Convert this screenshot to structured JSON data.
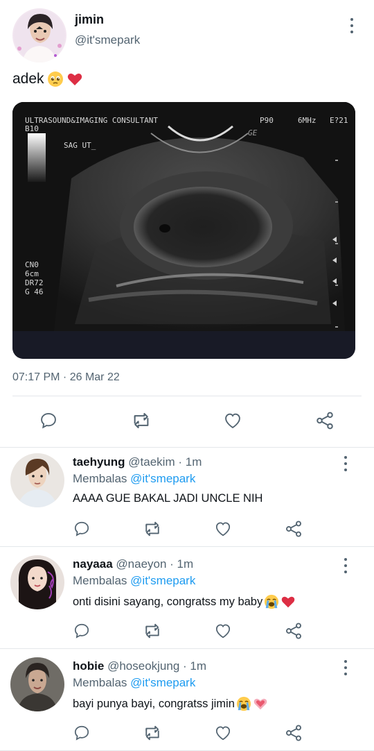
{
  "tweet": {
    "author_name": "jimin",
    "author_handle": "@it'smepark",
    "text": "adek",
    "emojis": [
      "pleading-face-emoji",
      "red-heart-emoji"
    ],
    "timestamp": "07:17 PM · 26 Mar 22",
    "media": {
      "header_left": "ULTRASOUND&IMAGING CONSULTANT",
      "header_p": "P90",
      "header_mhz": "6MHz",
      "header_e": "E?21",
      "b_value": "B10",
      "ge": "GE",
      "sag": "SAG UT_",
      "params": [
        "CN0",
        "6cm",
        "DR72",
        "G 46"
      ]
    }
  },
  "actions": [
    "reply-icon",
    "retweet-icon",
    "like-icon",
    "share-icon"
  ],
  "replies": [
    {
      "name": "taehyung",
      "handle": "@taekim",
      "time": "· 1m",
      "replying_prefix": "Membalas",
      "replying_to": "@it'smepark",
      "text": "AAAA GUE BAKAL JADI UNCLE NIH",
      "emojis": []
    },
    {
      "name": "nayaaa",
      "handle": "@naeyon",
      "time": "· 1m",
      "replying_prefix": "Membalas",
      "replying_to": "@it'smepark",
      "text": "onti disini sayang, congratss my baby",
      "emojis": [
        "loudly-crying-face-emoji",
        "red-heart-emoji"
      ]
    },
    {
      "name": "hobie",
      "handle": "@hoseokjung",
      "time": "· 1m",
      "replying_prefix": "Membalas",
      "replying_to": "@it'smepark",
      "text": "bayi punya bayi, congratss jimin",
      "emojis": [
        "loudly-crying-face-emoji",
        "growing-heart-emoji"
      ]
    }
  ],
  "colors": {
    "link": "#1d9bf0",
    "secondary_text": "#536471",
    "primary_text": "#0f1419",
    "divider": "#e4e7ea",
    "icon": "#536471"
  }
}
